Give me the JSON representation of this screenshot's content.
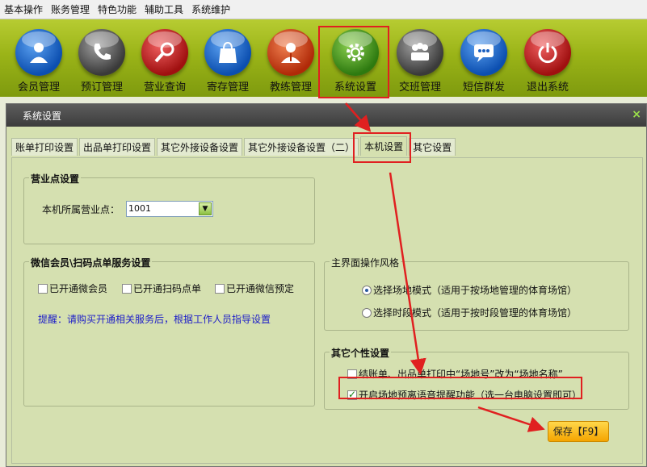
{
  "menubar": {
    "items": [
      "基本操作",
      "账务管理",
      "特色功能",
      "辅助工具",
      "系统维护"
    ]
  },
  "toolbar": {
    "items": [
      {
        "label": "会员管理",
        "icon": "member-icon",
        "color": "#1a5fc0"
      },
      {
        "label": "预订管理",
        "icon": "phone-icon",
        "color": "#4a4a4a"
      },
      {
        "label": "营业查询",
        "icon": "search-icon",
        "color": "#b01818"
      },
      {
        "label": "寄存管理",
        "icon": "bag-icon",
        "color": "#1a5fc0"
      },
      {
        "label": "教练管理",
        "icon": "coach-icon",
        "color": "#b02a08"
      },
      {
        "label": "系统设置",
        "icon": "gear-icon",
        "color": "#2e7a10"
      },
      {
        "label": "交班管理",
        "icon": "shift-icon",
        "color": "#4a4a4a"
      },
      {
        "label": "短信群发",
        "icon": "message-icon",
        "color": "#1a5fc0"
      },
      {
        "label": "退出系统",
        "icon": "power-icon",
        "color": "#b01818"
      }
    ]
  },
  "dialog": {
    "title": "系统设置",
    "close": "×",
    "tabs": [
      "账单打印设置",
      "出品单打印设置",
      "其它外接设备设置",
      "其它外接设备设置（二）",
      "本机设置",
      "其它设置"
    ],
    "active_tab": "本机设置"
  },
  "business": {
    "title": "营业点设置",
    "label": "本机所属营业点：",
    "value": "1001"
  },
  "wechat": {
    "title": "微信会员\\扫码点单服务设置",
    "options": [
      "已开通微会员",
      "已开通扫码点单",
      "已开通微信预定"
    ],
    "notice": "提醒：请购买开通相关服务后，根据工作人员指导设置"
  },
  "style": {
    "title": "主界面操作风格",
    "options": [
      "选择场地模式（适用于按场地管理的体育场馆）",
      "选择时段模式（适用于按时段管理的体育场馆）"
    ],
    "selected_index": 0
  },
  "personal": {
    "title": "其它个性设置",
    "options": [
      {
        "label": "结账单、出品单打印中“场地号”改为“场地名称”",
        "checked": false
      },
      {
        "label": "开启场地预离语音提醒功能（选一台电脑设置即可）",
        "checked": true
      }
    ]
  },
  "save_button": "保存【F9】",
  "colors": {
    "toolbar": "#9bb418",
    "panel": "#d5e0b0",
    "notice": "#1c1cc8",
    "annotation": "#e02020",
    "save": "#f5a400"
  }
}
